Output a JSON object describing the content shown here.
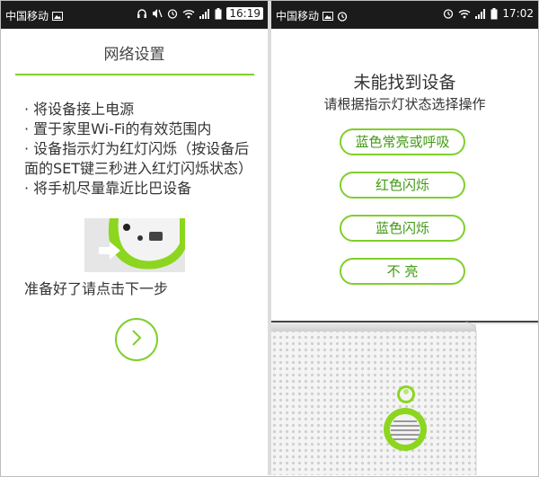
{
  "colors": {
    "accent": "#7fcf2b",
    "button_text": "#3f9a12",
    "status_bar": "#1b1b1b"
  },
  "left_screen": {
    "status_bar": {
      "carrier": "中国移动",
      "time": "16:19"
    },
    "title": "网络设置",
    "instructions": [
      "· 将设备接上电源",
      "· 置于家里Wi-Fi的有效范围内",
      "· 设备指示灯为红灯闪烁（按设备后面的SET键三秒进入红灯闪烁状态）",
      "· 将手机尽量靠近比巴设备"
    ],
    "ready_text": "准备好了请点击下一步",
    "next_icon": "chevron-right-icon"
  },
  "right_screen": {
    "status_bar": {
      "carrier": "中国移动",
      "time": "17:02"
    },
    "title": "未能找到设备",
    "subtitle": "请根据指示灯状态选择操作",
    "options": [
      "蓝色常亮或呼吸",
      "红色闪烁",
      "蓝色闪烁",
      "不 亮"
    ]
  }
}
